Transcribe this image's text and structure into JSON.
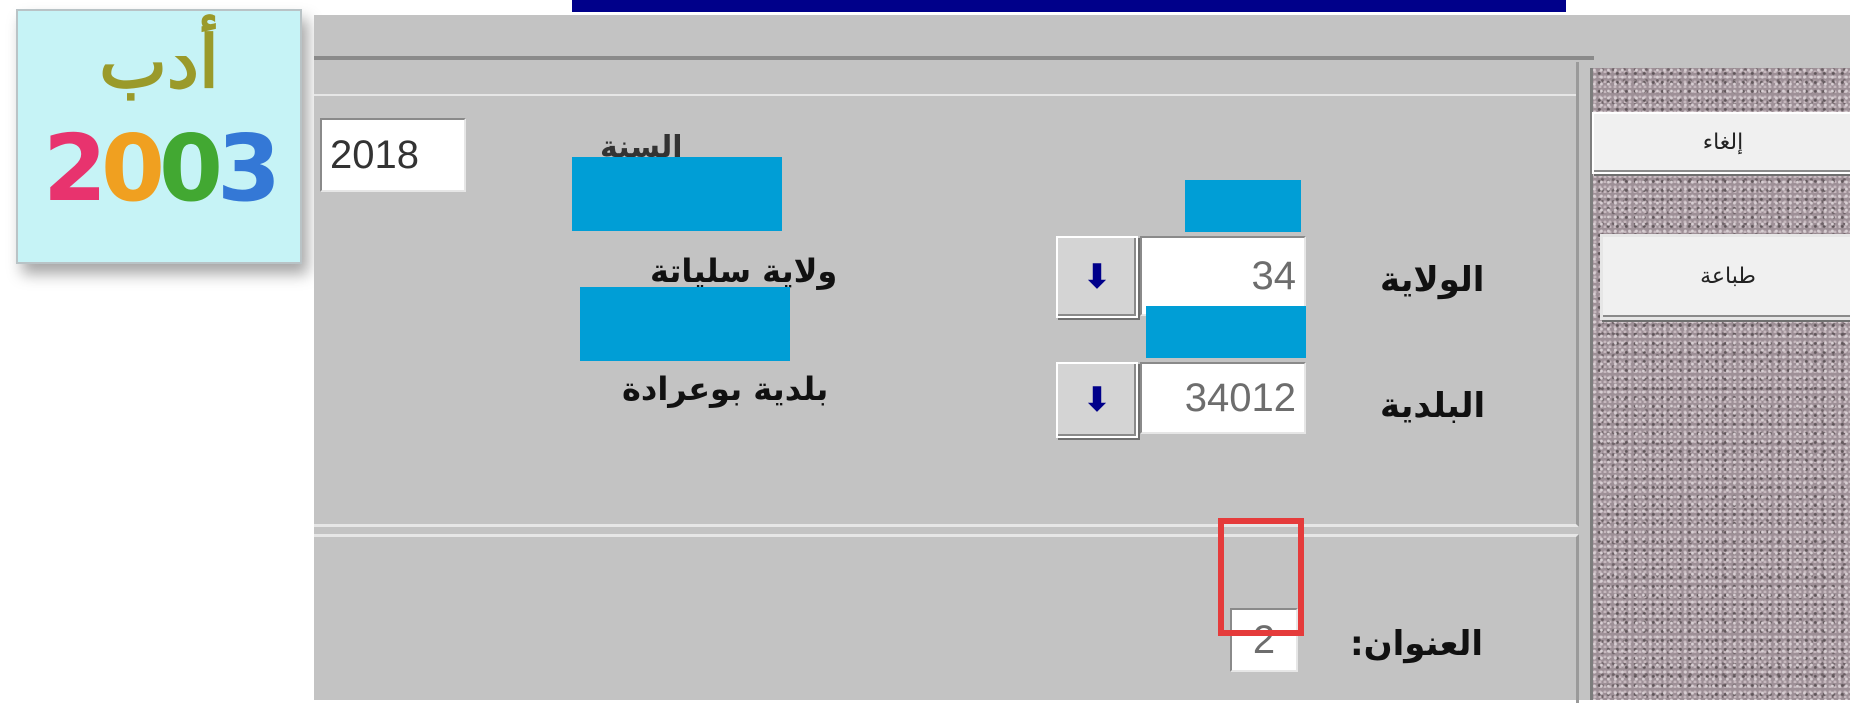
{
  "logo": {
    "word": "أدب",
    "year": [
      "2",
      "0",
      "0",
      "3"
    ]
  },
  "buttons": {
    "cancel": "إلغاء",
    "print": "طباعة"
  },
  "form": {
    "year_label": "السنة",
    "year_value": "2018",
    "wilaya_label": "الولاية",
    "wilaya_code": "34",
    "wilaya_name": "ولاية سلياتة",
    "baladia_label": "البلدية",
    "baladia_code": "34012",
    "baladia_name": "بلدية بوعرادة",
    "title_label": "العنوان:",
    "title_value": "2"
  },
  "icons": {
    "dropdown": "down-arrow-icon"
  },
  "colors": {
    "title_bar": "#00008a",
    "redaction": "#009ed6",
    "focus_box": "#e53b3b"
  }
}
